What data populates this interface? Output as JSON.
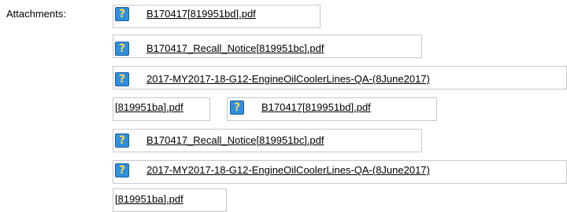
{
  "label": "Attachments:",
  "attachments": [
    {
      "name": "B170417[819951bd].pdf"
    },
    {
      "name": "B170417_Recall_Notice[819951bc].pdf"
    },
    {
      "name_line1": "2017-MY2017-18-G12-EngineOilCoolerLines-QA-(8June2017)",
      "name_line2": "[819951ba].pdf"
    },
    {
      "name": "B170417[819951bd].pdf"
    },
    {
      "name": "B170417_Recall_Notice[819951bc].pdf"
    },
    {
      "name_line1": "2017-MY2017-18-G12-EngineOilCoolerLines-QA-(8June2017)",
      "name_line2": "[819951ba].pdf"
    }
  ],
  "icon_glyph": "?",
  "colors": {
    "icon_bg": "#2f8fe0",
    "icon_glyph": "#ffd94a",
    "frame": "#c8c8c8"
  }
}
